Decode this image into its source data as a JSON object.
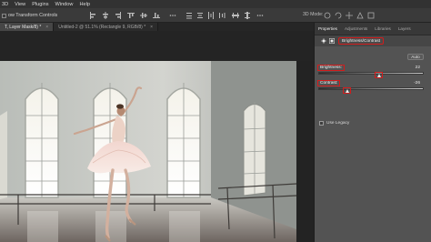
{
  "menu": [
    "3D",
    "View",
    "Plugins",
    "Window",
    "Help"
  ],
  "options_bar": {
    "show_transform_controls": "ow Transform Controls",
    "mode_3d_label": "3D Mode:"
  },
  "tabs": [
    {
      "label": "T, Layer Mask/8) *",
      "active": true
    },
    {
      "label": "Untitled-2 @ 51.1% (Rectangle 9, RGB/8) *",
      "active": false
    }
  ],
  "panel": {
    "tabs": [
      "Properties",
      "Adjustments",
      "Libraries",
      "Layers"
    ],
    "adjustment_name": "Brightness/Contrast",
    "auto_label": "Auto",
    "brightness": {
      "label": "Brightness:",
      "value": "22"
    },
    "contrast": {
      "label": "Contrast:",
      "value": "-26"
    },
    "use_legacy_label": "Use Legacy"
  },
  "colors": {
    "highlight": "#d21c1c",
    "panel_bg": "#535353",
    "app_bg": "#262626"
  }
}
